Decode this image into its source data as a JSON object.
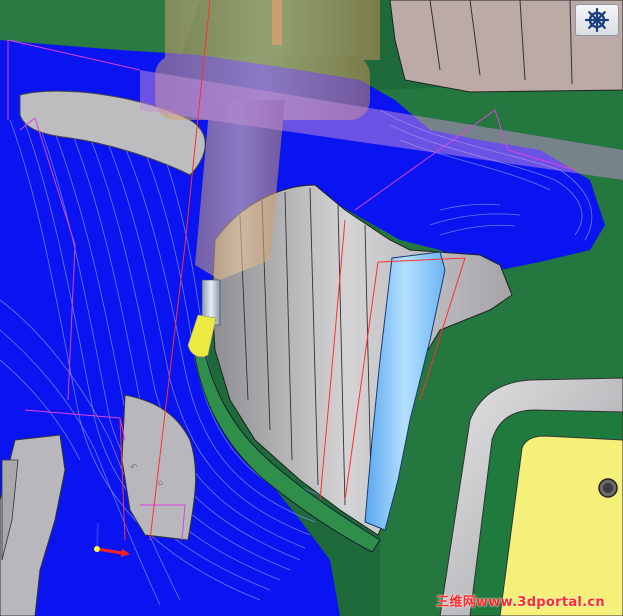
{
  "app": {
    "toolbar": {
      "view_navigator_icon": "ship-wheel-icon"
    },
    "watermark": {
      "text": "三维网www.3dportal.cn"
    },
    "colors": {
      "background": "#1e6a3a",
      "toolpath_fill": "#0a14f0",
      "toolpath_lines": "#7c8cff",
      "part_grey": "#b8b8bc",
      "cyan_surface": "#8cc8ff",
      "yellow_face": "#f4f07a",
      "tool_holder": "#e6b07a",
      "magenta_path": "#e040e0",
      "red_path": "#ff3030",
      "axis_x": "#ff2020",
      "axis_y": "#20c020",
      "axis_z": "#3030ff"
    }
  }
}
